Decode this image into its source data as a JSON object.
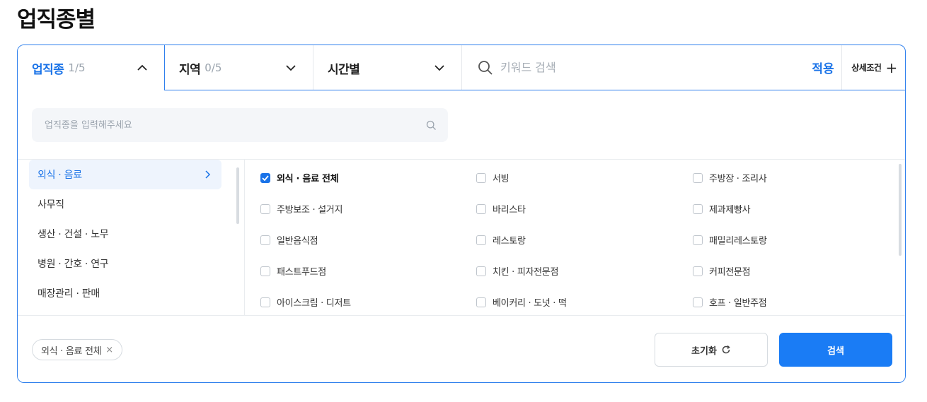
{
  "page": {
    "title": "업직종별"
  },
  "filters": {
    "tabs": [
      {
        "label": "업직종",
        "count": "1/5"
      },
      {
        "label": "지역",
        "count": "0/5"
      },
      {
        "label": "시간별",
        "count": ""
      }
    ],
    "keyword_placeholder": "키워드 검색",
    "apply_label": "적용",
    "detail_label": "상세조건",
    "detail_icon": "+"
  },
  "job_search": {
    "placeholder": "업직종을 입력해주세요",
    "value": ""
  },
  "categories": [
    "외식 · 음료",
    "사무직",
    "생산 · 건설 · 노무",
    "병원 · 간호 · 연구",
    "매장관리 · 판매"
  ],
  "options": [
    "외식 · 음료 전체",
    "서빙",
    "주방장 · 조리사",
    "주방보조 · 설거지",
    "바리스타",
    "제과제빵사",
    "일반음식점",
    "레스토랑",
    "패밀리레스토랑",
    "패스트푸드점",
    "치킨 · 피자전문점",
    "커피전문점",
    "아이스크림 · 디저트",
    "베이커리 · 도넛 · 떡",
    "호프 · 일반주점"
  ],
  "selected_chip": {
    "label": "외식 · 음료 전체",
    "remove": "×"
  },
  "buttons": {
    "reset": "초기화",
    "search": "검색"
  },
  "colors": {
    "accent": "#1a73e8",
    "primary_button": "#1a7cf5"
  }
}
